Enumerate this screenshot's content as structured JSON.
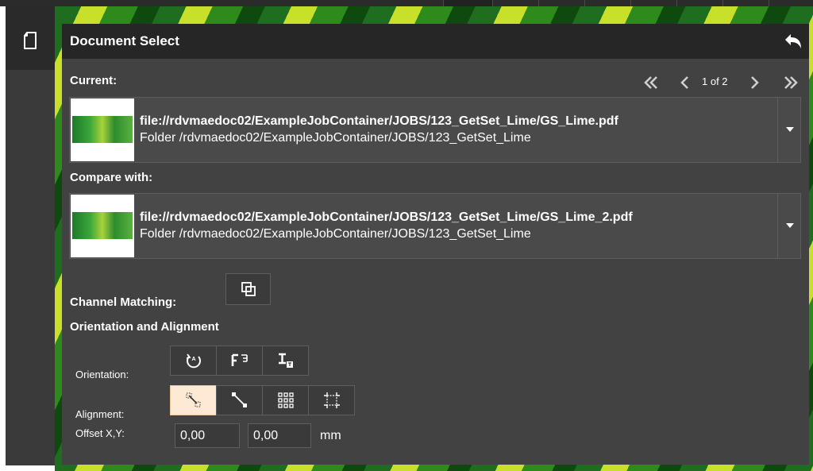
{
  "panel": {
    "title": "Document Select",
    "undo_icon": "undo-icon"
  },
  "current": {
    "label": "Current:",
    "pager": {
      "first_icon": "double-chevron-left-icon",
      "prev_icon": "chevron-left-icon",
      "text": "1 of 2",
      "next_icon": "chevron-right-icon",
      "last_icon": "double-chevron-right-icon"
    },
    "file": "file://rdvmaedoc02/ExampleJobContainer/JOBS/123_GetSet_Lime/GS_Lime.pdf",
    "folder": "Folder /rdvmaedoc02/ExampleJobContainer/JOBS/123_GetSet_Lime"
  },
  "compare": {
    "label": "Compare with:",
    "file": "file://rdvmaedoc02/ExampleJobContainer/JOBS/123_GetSet_Lime/GS_Lime_2.pdf",
    "folder": "Folder /rdvmaedoc02/ExampleJobContainer/JOBS/123_GetSet_Lime"
  },
  "channel_matching": {
    "label": "Channel Matching:",
    "icon": "overlap-squares-icon"
  },
  "orientation_alignment": {
    "heading": "Orientation and Alignment"
  },
  "orientation": {
    "label": "Orientation:",
    "buttons": [
      "rotate-auto-icon",
      "mirror-text-icon",
      "flip-text-icon"
    ]
  },
  "alignment": {
    "label": "Alignment:",
    "buttons": [
      "align-corner-icon",
      "align-diagonal-icon",
      "align-grid-icon",
      "align-crop-marks-icon"
    ],
    "active_index": 0
  },
  "offset": {
    "label": "Offset X,Y:",
    "x": "0,00",
    "y": "0,00",
    "unit": "mm"
  },
  "side_rail": {
    "document_icon": "document-icon"
  },
  "colors": {
    "panel_bg": "#424242",
    "header_bg": "#262626",
    "active_button": "#fde9d4"
  }
}
